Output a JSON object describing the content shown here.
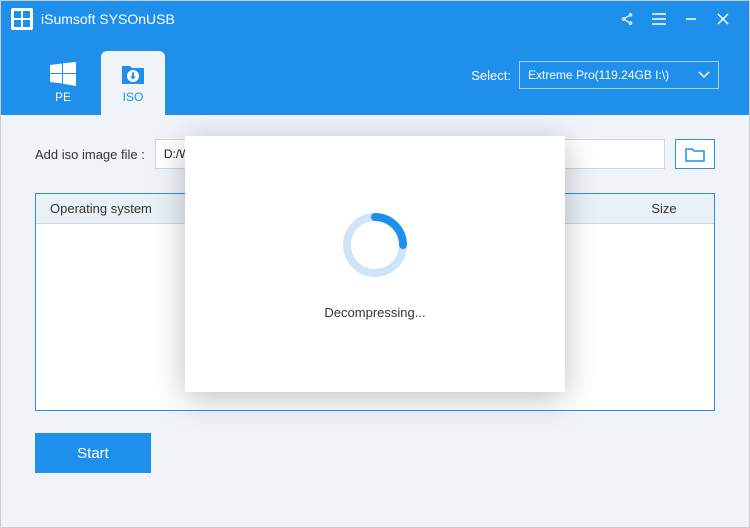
{
  "titlebar": {
    "title": "iSumsoft SYSOnUSB"
  },
  "tabs": {
    "pe": "PE",
    "iso": "ISO"
  },
  "select": {
    "label": "Select:",
    "value": "Extreme Pro(119.24GB I:\\)"
  },
  "addiso": {
    "label": "Add iso image file :",
    "path": "D:/W"
  },
  "table": {
    "colOS": "Operating system",
    "colSize": "Size"
  },
  "start": {
    "label": "Start"
  },
  "modal": {
    "status": "Decompressing..."
  }
}
